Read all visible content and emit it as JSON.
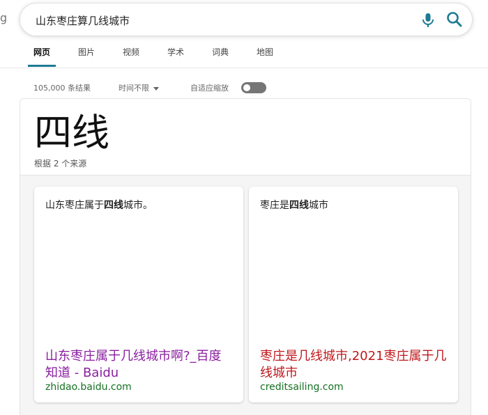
{
  "logo_fragment": "g",
  "search": {
    "query": "山东枣庄算几线城市"
  },
  "tabs": [
    {
      "label": "网页",
      "active": true
    },
    {
      "label": "图片",
      "active": false
    },
    {
      "label": "视频",
      "active": false
    },
    {
      "label": "学术",
      "active": false
    },
    {
      "label": "词典",
      "active": false
    },
    {
      "label": "地图",
      "active": false
    }
  ],
  "meta": {
    "result_count": "105,000 条结果",
    "time_filter": "时间不限",
    "adaptive_zoom": "自适应缩放"
  },
  "answer": {
    "title": "四线",
    "source_note": "根据 2 个来源",
    "cards": [
      {
        "snippet_pre": "山东枣庄属于",
        "snippet_bold": "四线",
        "snippet_post": "城市。",
        "link_title": "山东枣庄属于几线城市啊?_百度知道 - Baidu",
        "domain": "zhidao.baidu.com"
      },
      {
        "snippet_pre": "枣庄是",
        "snippet_bold": "四线",
        "snippet_post": "城市",
        "link_title": "枣庄是几线城市,2021枣庄属于几线城市",
        "domain": "creditsailing.com"
      }
    ]
  },
  "colors": {
    "accent": "#1d7a93",
    "link_visited": "#8a1ea0",
    "link_red": "#c0181c",
    "domain_green": "#157022"
  }
}
